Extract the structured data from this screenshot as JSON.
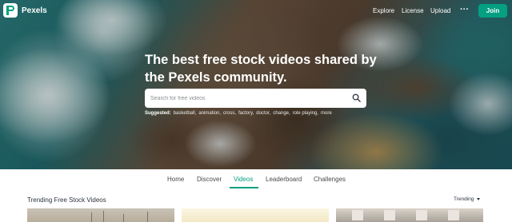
{
  "header": {
    "brand": "Pexels",
    "nav": [
      "Explore",
      "License",
      "Upload"
    ],
    "more_label": "···",
    "join_label": "Join"
  },
  "hero": {
    "headline": "The best free stock videos shared by the Pexels community.",
    "search_placeholder": "Search for free videos",
    "suggested_label": "Suggested:",
    "suggested": [
      "basketball,",
      "animation,",
      "cross,",
      "factory,",
      "doctor,",
      "change,",
      "role playing,",
      "more"
    ]
  },
  "tabs": [
    {
      "label": "Home",
      "active": false
    },
    {
      "label": "Discover",
      "active": false
    },
    {
      "label": "Videos",
      "active": true
    },
    {
      "label": "Leaderboard",
      "active": false
    },
    {
      "label": "Challenges",
      "active": false
    }
  ],
  "trending": {
    "title": "Trending Free Stock Videos",
    "sort_label": "Trending"
  },
  "colors": {
    "accent": "#05a081",
    "text": "#2c343e"
  },
  "icons": [
    "pexels-logo-icon",
    "more-icon",
    "search-icon",
    "chevron-down-icon"
  ]
}
